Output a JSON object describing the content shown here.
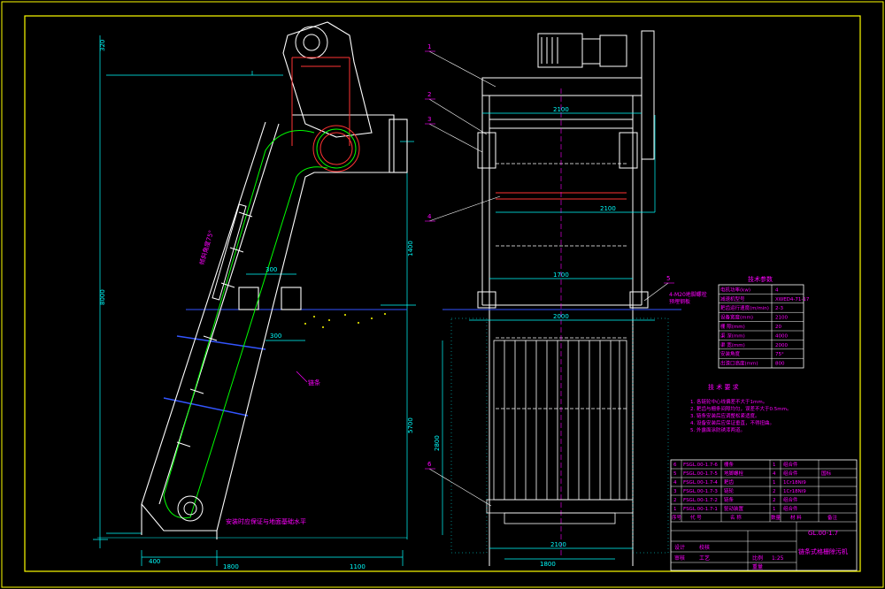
{
  "colors": {
    "background": "#000000",
    "frame": "#ffff00",
    "machine": "#ffffff",
    "chain": "#00ff00",
    "dimension": "#00ffff",
    "annotation": "#ff00ff",
    "motor": "#ff3333",
    "water": "#3355ff"
  },
  "side_view": {
    "dims": {
      "top": "320",
      "overall_height": "8000",
      "upper_height": "1400",
      "lower_height": "5700",
      "inner_width": "300",
      "bottom_span": "1800",
      "right_span": "1100",
      "foot": "400",
      "small_offset": "300"
    },
    "notes": {
      "incline_label": "倾斜角度75°",
      "chain_label": "链条",
      "bottom_note": "安装时应保证与地面基础水平"
    }
  },
  "front_view": {
    "callouts": [
      "1",
      "2",
      "3",
      "4",
      "5",
      "6"
    ],
    "dims": {
      "top_width": "2100",
      "mid_width": "2100",
      "frame_width": "1700",
      "base_width": "2000",
      "screen_height": "2800",
      "bottom_width": "2100",
      "channel_width": "1800"
    },
    "anchor_label": "4-M20地脚螺栓",
    "anchor_sub": "预埋钢板"
  },
  "tech_params": {
    "title": "技术参数",
    "rows": [
      {
        "name": "电机功率(kw)",
        "value": "4"
      },
      {
        "name": "减速机型号",
        "value": "XWED4-71-17"
      },
      {
        "name": "耙齿运行速度(m/min)",
        "value": "2-3"
      },
      {
        "name": "设备宽度(mm)",
        "value": "2100"
      },
      {
        "name": "栅  隙(mm)",
        "value": "20"
      },
      {
        "name": "渠  深(mm)",
        "value": "4000"
      },
      {
        "name": "渠  宽(mm)",
        "value": "2000"
      },
      {
        "name": "安装角度",
        "value": "75°"
      },
      {
        "name": "出渣口高度(mm)",
        "value": "800"
      }
    ]
  },
  "tech_requirements": {
    "title": "技 术 要 求",
    "items": [
      "1. 各链轮中心线偏差不大于1mm。",
      "2. 耙齿与栅条间隙均匀，误差不大于0.5mm。",
      "3. 链条安装后应调整松紧适度。",
      "4. 设备安装后应保证垂直，不得扭曲。",
      "5. 外露面涂防锈漆两道。"
    ]
  },
  "parts_list": {
    "rows": [
      {
        "no": "6",
        "code": "FSGL.00-1.7-6",
        "name": "栅条",
        "qty": "1",
        "mat": "组合件",
        "note": ""
      },
      {
        "no": "5",
        "code": "FSGL.00-1.7-5",
        "name": "地脚螺栓",
        "qty": "4",
        "mat": "组合件",
        "note": "国标"
      },
      {
        "no": "4",
        "code": "FSGL.00-1.7-4",
        "name": "耙齿",
        "qty": "1",
        "mat": "1Cr18Ni9",
        "note": ""
      },
      {
        "no": "3",
        "code": "FSGL.00-1.7-3",
        "name": "链轮",
        "qty": "2",
        "mat": "1Cr18Ni9",
        "note": ""
      },
      {
        "no": "2",
        "code": "FSGL.00-1.7-2",
        "name": "链条",
        "qty": "2",
        "mat": "组合件",
        "note": ""
      },
      {
        "no": "1",
        "code": "FSGL.00-1.7-1",
        "name": "驱动装置",
        "qty": "1",
        "mat": "组合件",
        "note": ""
      }
    ],
    "header": {
      "no": "序号",
      "code": "代  号",
      "name": "名  称",
      "qty": "数量",
      "mat": "材  料",
      "note": "备注"
    }
  },
  "title_block": {
    "drawing_no": "GL.00-1.7",
    "drawing_name": "链条式格栅除污机",
    "labels": [
      "设计",
      "校核",
      "审核",
      "工艺",
      "比例",
      "重量"
    ],
    "scale": "1:25"
  }
}
